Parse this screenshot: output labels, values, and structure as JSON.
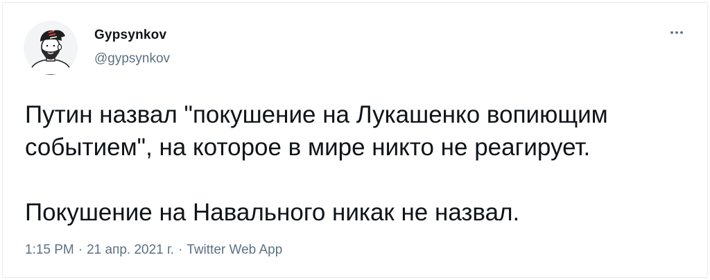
{
  "user": {
    "display_name": "Gypsynkov",
    "handle": "@gypsynkov"
  },
  "tweet": {
    "paragraphs": [
      "Путин назвал \"покушение на Лукашенко вопиющим событием\", на которое в мире никто не реагирует.",
      "Покушение на Навального никак не назвал."
    ],
    "time": "1:15 PM",
    "date": "21 апр. 2021 г.",
    "separator": "·",
    "source": "Twitter Web App"
  },
  "icons": {
    "avatar": "avatar-illustration",
    "more": "more-options-icon"
  },
  "colors": {
    "text_primary": "#0f1419",
    "text_secondary": "#5b7083",
    "border": "#e6ecf0"
  }
}
